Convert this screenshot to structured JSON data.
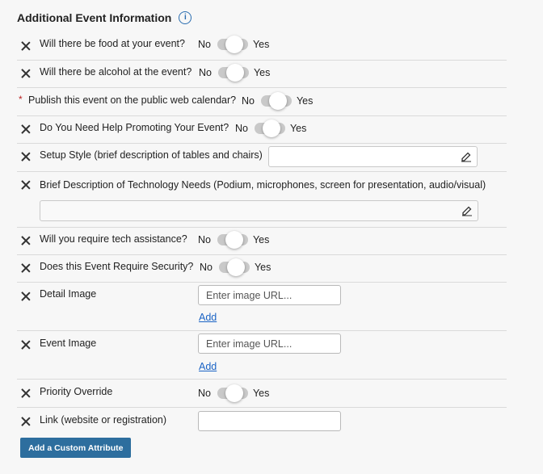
{
  "section": {
    "title": "Additional Event Information",
    "info_icon_glyph": "i"
  },
  "toggle_no": "No",
  "toggle_yes": "Yes",
  "rows": {
    "food": {
      "label": "Will there be food at your event?"
    },
    "alcohol": {
      "label": "Will there be alcohol at the event?"
    },
    "publish": {
      "label": "Publish this event on the public web calendar?",
      "required_mark": "*"
    },
    "promo": {
      "label": "Do You Need Help Promoting Your Event?"
    },
    "setup": {
      "label": "Setup Style (brief description of tables and chairs)"
    },
    "tech_needs": {
      "label": "Brief Description of Technology Needs (Podium, microphones, screen for presentation, audio/visual)"
    },
    "tech_assist": {
      "label": "Will you require tech assistance?"
    },
    "security": {
      "label": "Does this Event Require Security?"
    },
    "detail_image": {
      "label": "Detail Image",
      "placeholder": "Enter image URL...",
      "add_label": "Add"
    },
    "event_image": {
      "label": "Event Image",
      "placeholder": "Enter image URL...",
      "add_label": "Add"
    },
    "priority": {
      "label": "Priority Override"
    },
    "link": {
      "label": "Link (website or registration)",
      "value": ""
    }
  },
  "custom_attribute_button": "Add a Custom Attribute",
  "colors": {
    "accent_blue": "#2d6e9e",
    "link_blue": "#1a63c5",
    "required_red": "#b22222"
  }
}
